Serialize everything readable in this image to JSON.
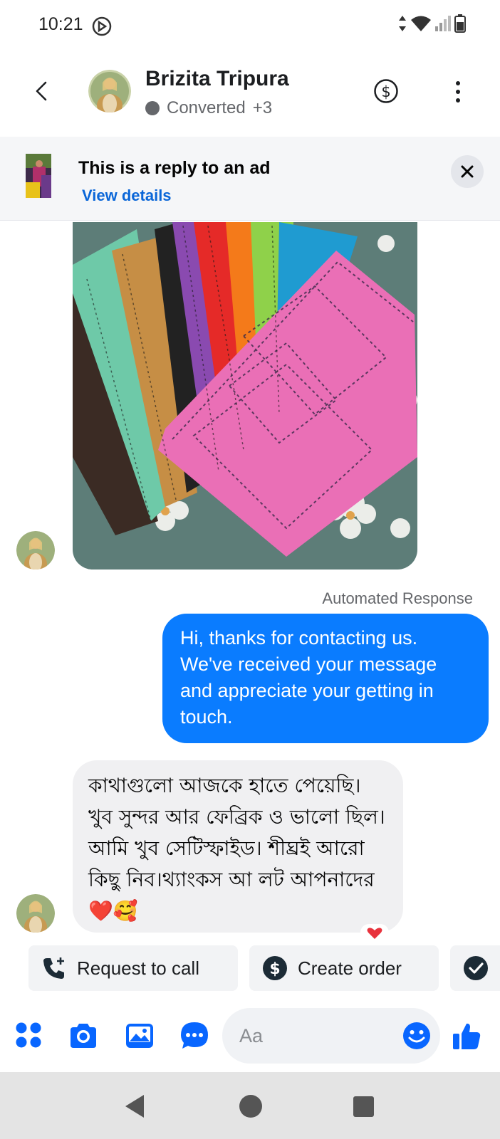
{
  "status_bar": {
    "time": "10:21"
  },
  "header": {
    "contact_name": "Brizita Tripura",
    "status_label": "Converted",
    "status_extra": "+3"
  },
  "ad_banner": {
    "title": "This is a reply to an ad",
    "link": "View details"
  },
  "messages": {
    "automated_label": "Automated Response",
    "outgoing_text": "Hi, thanks for contacting us. We've received your message and appreciate your getting in touch.",
    "incoming_text": "কাথাগুলো আজকে হাতে পেয়েছি। খুব সুন্দর আর ফেব্রিক ও ভালো ছিল।আমি খুব সেটিস্ফাইড। শীঘ্রই আরো কিছু নিব।থ্যাংকস আ লট আপনাদের❤️🥰",
    "reaction": "❤️"
  },
  "quick_actions": {
    "request_call": "Request to call",
    "create_order": "Create order"
  },
  "composer": {
    "placeholder": "Aa"
  },
  "colors": {
    "accent": "#0a7cff",
    "link": "#0a66d8",
    "incoming_bubble": "#f0f0f2",
    "icon_blue": "#0866ff"
  },
  "icons": {
    "back": "chevron-left-icon",
    "payment": "dollar-circle-icon",
    "more": "more-vertical-icon",
    "close": "close-icon",
    "call": "phone-add-icon",
    "order": "dollar-circle-icon",
    "check": "check-circle-icon",
    "apps": "grid-dots-icon",
    "camera": "camera-icon",
    "gallery": "image-icon",
    "chat": "chat-bubble-icon",
    "emoji": "smiley-icon",
    "like": "thumbs-up-icon"
  }
}
